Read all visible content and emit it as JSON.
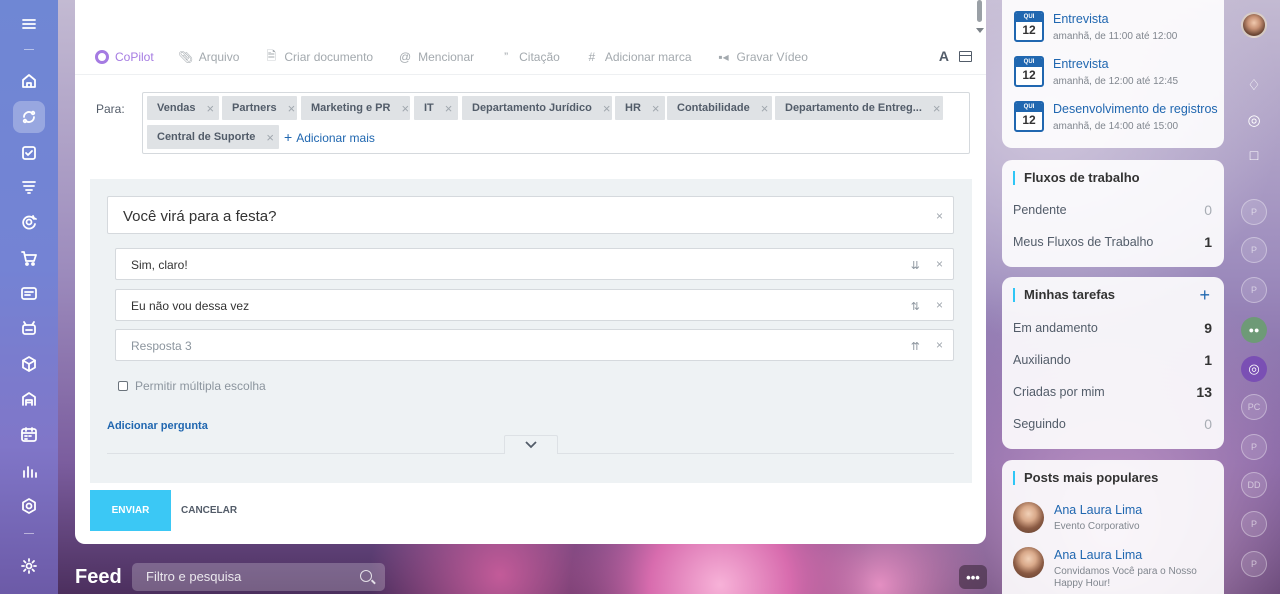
{
  "left_nav": {
    "items": [
      "menu-icon",
      "home-icon",
      "feed-icon",
      "tasks-icon",
      "crm-icon",
      "copilot-icon",
      "shop-icon",
      "sites-icon",
      "automation-icon",
      "inventory-icon",
      "warehouse-icon",
      "calendar-icon",
      "analytics-icon",
      "marketplace-icon",
      "settings-icon"
    ],
    "active": "feed-icon"
  },
  "toolbar": {
    "copilot": "CoPilot",
    "file": "Arquivo",
    "create_doc": "Criar documento",
    "mention": "Mencionar",
    "quote": "Citação",
    "add_tag": "Adicionar marca",
    "record_video": "Gravar Vídeo",
    "font_button": "A"
  },
  "recipients": {
    "label": "Para:",
    "chips": [
      "Vendas",
      "Partners",
      "Marketing e PR",
      "IT",
      "Departamento Jurídico",
      "HR",
      "Contabilidade",
      "Departamento de Entreg...",
      "Central de Suporte"
    ],
    "add_more": "Adicionar mais"
  },
  "poll": {
    "question": "Você virá para a festa?",
    "answers": [
      {
        "text": "Sim, claro!",
        "placeholder": false,
        "sort": "⇊"
      },
      {
        "text": "Eu não vou dessa vez",
        "placeholder": false,
        "sort": "⇅"
      },
      {
        "text": "Resposta 3",
        "placeholder": true,
        "sort": "⇈"
      }
    ],
    "multiple_choice": "Permitir múltipla escolha",
    "add_question": "Adicionar pergunta"
  },
  "actions": {
    "send": "ENVIAR",
    "cancel": "CANCELAR"
  },
  "feed": {
    "title": "Feed",
    "search_placeholder": "Filtro e pesquisa",
    "more": "•••"
  },
  "events": [
    {
      "dow": "QUI",
      "day": "12",
      "title": "Entrevista",
      "time": "amanhã, de 11:00 até 12:00"
    },
    {
      "dow": "QUI",
      "day": "12",
      "title": "Entrevista",
      "time": "amanhã, de 12:00 até 12:45"
    },
    {
      "dow": "QUI",
      "day": "12",
      "title": "Desenvolvimento de registros",
      "time": "amanhã, de 14:00 até 15:00"
    }
  ],
  "workflows": {
    "title": "Fluxos de trabalho",
    "rows": [
      {
        "label": "Pendente",
        "count": "0"
      },
      {
        "label": "Meus Fluxos de Trabalho",
        "count": "1"
      }
    ]
  },
  "tasks": {
    "title": "Minhas tarefas",
    "plus": "+",
    "rows": [
      {
        "label": "Em andamento",
        "count": "9"
      },
      {
        "label": "Auxiliando",
        "count": "1"
      },
      {
        "label": "Criadas por mim",
        "count": "13"
      },
      {
        "label": "Seguindo",
        "count": "0"
      }
    ]
  },
  "popular_posts": {
    "title": "Posts mais populares",
    "posts": [
      {
        "name": "Ana Laura Lima",
        "desc": "Evento Corporativo"
      },
      {
        "name": "Ana Laura Lima",
        "desc": "Convidamos Você para o Nosso Happy Hour!"
      }
    ]
  },
  "right_bar": {
    "items": [
      "user-avatar",
      "bell-icon",
      "copilot-icon",
      "chat-icon",
      "P",
      "P",
      "P",
      "group-avatar",
      "copilot-icon",
      "PC",
      "P",
      "DD",
      "P",
      "P"
    ]
  },
  "colors": {
    "accent": "#3bc8f5",
    "link": "#2067b0",
    "copilot": "#a57be2"
  }
}
